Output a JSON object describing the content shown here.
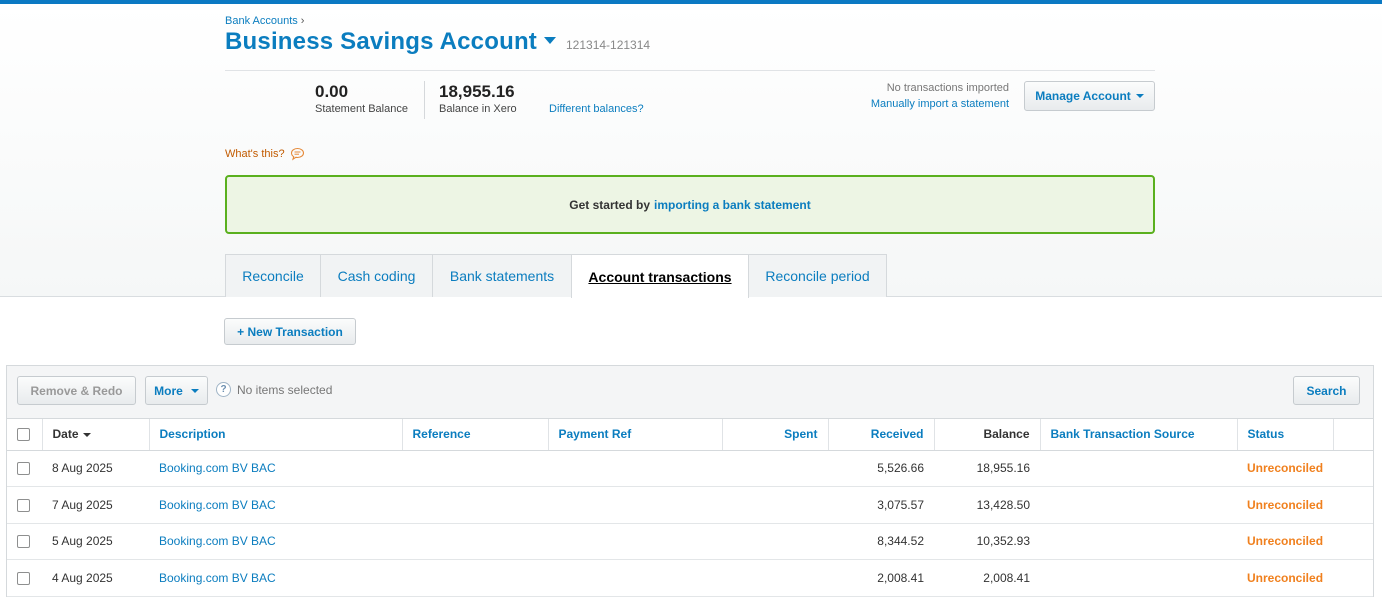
{
  "breadcrumb": {
    "label": "Bank Accounts",
    "sep": "›"
  },
  "account": {
    "name": "Business Savings Account",
    "number": "121314-121314"
  },
  "balances": {
    "statement_value": "0.00",
    "statement_label": "Statement Balance",
    "xero_value": "18,955.16",
    "xero_label": "Balance in Xero",
    "different_link": "Different balances?"
  },
  "import": {
    "status": "No transactions imported",
    "link": "Manually import a statement"
  },
  "manage_button": "Manage Account",
  "whats_this": "What's this?",
  "get_started": {
    "prefix": "Get started by",
    "link": "importing a bank statement"
  },
  "tabs": [
    {
      "label": "Reconcile"
    },
    {
      "label": "Cash coding"
    },
    {
      "label": "Bank statements"
    },
    {
      "label": "Account transactions"
    },
    {
      "label": "Reconcile period"
    }
  ],
  "new_transaction": "+ New Transaction",
  "toolbar": {
    "remove_redo": "Remove & Redo",
    "more": "More",
    "selected": "No items selected",
    "search": "Search"
  },
  "table": {
    "headers": {
      "date": "Date",
      "description": "Description",
      "reference": "Reference",
      "payment_ref": "Payment Ref",
      "spent": "Spent",
      "received": "Received",
      "balance": "Balance",
      "source": "Bank Transaction Source",
      "status": "Status"
    },
    "rows": [
      {
        "date": "8 Aug 2025",
        "description": "Booking.com BV BAC",
        "reference": "",
        "payment_ref": "",
        "spent": "",
        "received": "5,526.66",
        "balance": "18,955.16",
        "source": "",
        "status": "Unreconciled"
      },
      {
        "date": "7 Aug 2025",
        "description": "Booking.com BV BAC",
        "reference": "",
        "payment_ref": "",
        "spent": "",
        "received": "3,075.57",
        "balance": "13,428.50",
        "source": "",
        "status": "Unreconciled"
      },
      {
        "date": "5 Aug 2025",
        "description": "Booking.com BV BAC",
        "reference": "",
        "payment_ref": "",
        "spent": "",
        "received": "8,344.52",
        "balance": "10,352.93",
        "source": "",
        "status": "Unreconciled"
      },
      {
        "date": "4 Aug 2025",
        "description": "Booking.com BV BAC",
        "reference": "",
        "payment_ref": "",
        "spent": "",
        "received": "2,008.41",
        "balance": "2,008.41",
        "source": "",
        "status": "Unreconciled"
      }
    ]
  }
}
